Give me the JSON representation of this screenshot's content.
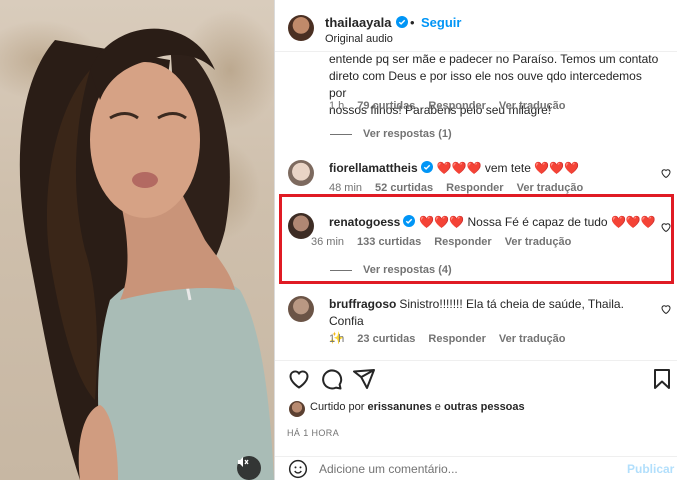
{
  "header": {
    "username": "thailaayala",
    "separator": "•",
    "follow_label": "Seguir",
    "subtitle": "Original audio"
  },
  "comments": [
    {
      "text_line1": "entende pq ser mãe e padecer no Paraíso. Temos um contato",
      "text_line2": "direto com Deus e por isso ele nos ouve qdo intercedemos por",
      "text_line3": "nossos filhos! Parabéns pelo seu milagre!",
      "time": "1 h",
      "likes": "79 curtidas",
      "reply": "Responder",
      "translate": "Ver tradução",
      "view_replies": "Ver respostas (1)"
    },
    {
      "username": "fiorellamattheis",
      "text": "❤️❤️❤️ vem tete ❤️❤️❤️",
      "time": "48 min",
      "likes": "52 curtidas",
      "reply": "Responder",
      "translate": "Ver tradução"
    },
    {
      "username": "renatogoess",
      "text": "❤️❤️❤️ Nossa Fé é capaz de tudo ❤️❤️❤️",
      "time": "36 min",
      "likes": "133 curtidas",
      "reply": "Responder",
      "translate": "Ver tradução",
      "view_replies": "Ver respostas (4)"
    },
    {
      "username": "bruffragoso",
      "text_line1": "Sinistro!!!!!!! Ela tá cheia de saúde, Thaila. Confia",
      "text_line2": "✨",
      "time": "1 h",
      "likes": "23 curtidas",
      "reply": "Responder",
      "translate": "Ver tradução"
    }
  ],
  "liked_by": {
    "prefix": "Curtido por",
    "user": "erissanunes",
    "suffix": "e",
    "others": "outras pessoas"
  },
  "timestamp": "HÁ 1 HORA",
  "add_comment": {
    "placeholder": "Adicione um comentário...",
    "publish_label": "Publicar"
  },
  "colors": {
    "accent": "#0095f6",
    "highlight": "#e01b24",
    "muted": "#737373"
  },
  "icons": [
    "verified-badge-icon",
    "heart-icon",
    "comment-icon",
    "share-icon",
    "bookmark-icon",
    "emoji-icon",
    "mute-icon"
  ]
}
